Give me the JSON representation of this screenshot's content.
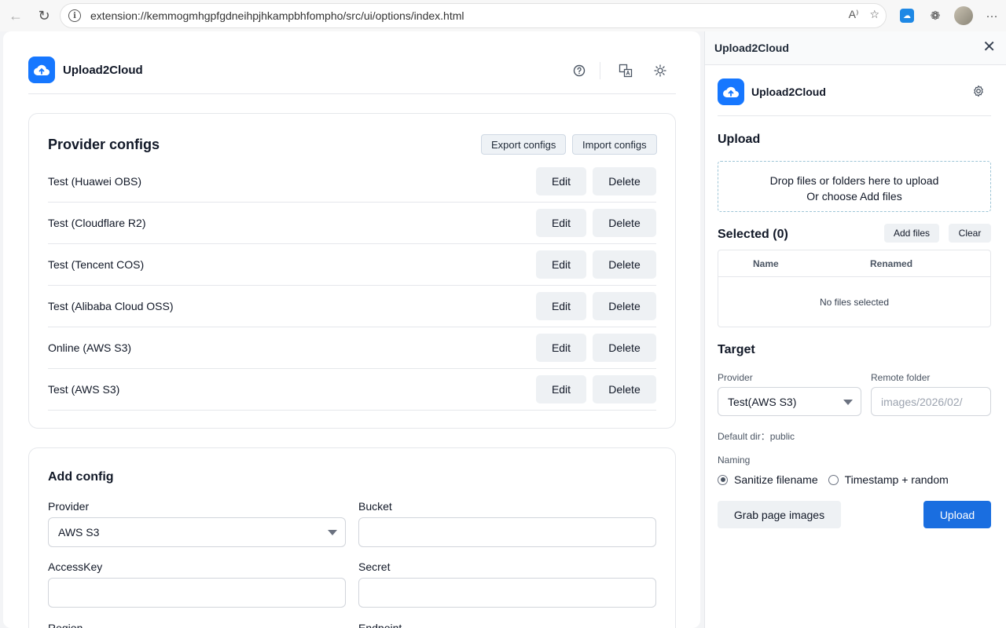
{
  "browser": {
    "url": "extension://kemmogmhgpfgdneihpjhkampbhfompho/src/ui/options/index.html",
    "read_aloud_glyph": "A⁾"
  },
  "app": {
    "name": "Upload2Cloud"
  },
  "provider_configs": {
    "title": "Provider configs",
    "export_label": "Export configs",
    "import_label": "Import configs",
    "edit_label": "Edit",
    "delete_label": "Delete",
    "items": [
      {
        "name": "Test (Huawei OBS)"
      },
      {
        "name": "Test (Cloudflare R2)"
      },
      {
        "name": "Test (Tencent COS)"
      },
      {
        "name": "Test (Alibaba Cloud OSS)"
      },
      {
        "name": "Online (AWS S3)"
      },
      {
        "name": "Test (AWS S3)"
      }
    ]
  },
  "add_config": {
    "title": "Add config",
    "provider_label": "Provider",
    "provider_value": "AWS S3",
    "bucket_label": "Bucket",
    "accesskey_label": "AccessKey",
    "secret_label": "Secret",
    "region_label": "Region",
    "endpoint_label": "Endpoint"
  },
  "panel": {
    "title": "Upload2Cloud",
    "upload_title": "Upload",
    "drop_line1": "Drop files or folders here to upload",
    "drop_line2": "Or choose Add files",
    "selected_title": "Selected (0)",
    "add_files_label": "Add files",
    "clear_label": "Clear",
    "col_name": "Name",
    "col_renamed": "Renamed",
    "empty_text": "No files selected",
    "target_title": "Target",
    "provider_label": "Provider",
    "provider_value": "Test(AWS S3)",
    "remote_folder_label": "Remote folder",
    "remote_folder_placeholder": "images/2026/02/",
    "default_dir": "Default dir：public",
    "naming_label": "Naming",
    "naming_option1": "Sanitize filename",
    "naming_option2": "Timestamp + random",
    "grab_label": "Grab page images",
    "upload_label": "Upload"
  },
  "colors": {
    "accent": "#1a6ee0",
    "logo": "#1677ff"
  }
}
